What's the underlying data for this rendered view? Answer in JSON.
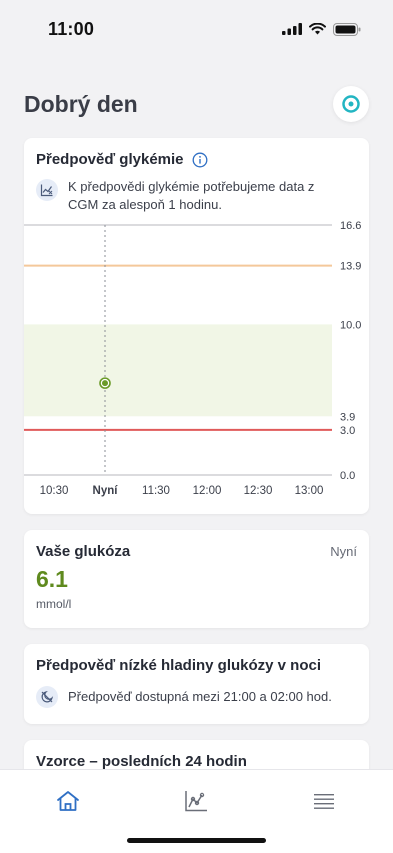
{
  "status_bar": {
    "time": "11:00"
  },
  "header": {
    "title": "Dobrý den"
  },
  "forecast": {
    "title": "Předpověď glykémie",
    "note": "K předpovědi glykémie potřebujeme data z CGM za alespoň 1 hodinu.",
    "chart_data": {
      "type": "scatter",
      "x_ticks": [
        "10:30",
        "Nyní",
        "11:30",
        "12:00",
        "12:30",
        "13:00"
      ],
      "current_tick": "Nyní",
      "y_ticks": [
        16.6,
        13.9,
        10.0,
        3.9,
        3.0,
        0.0
      ],
      "ylim": [
        0.0,
        16.6
      ],
      "target_range": [
        3.9,
        10.0
      ],
      "high_threshold": 13.9,
      "low_threshold": 3.0,
      "points": [
        {
          "x": "Nyní",
          "y": 6.1
        }
      ],
      "colors": {
        "target_band": "#f1f6e6",
        "high_line": "#f4c89a",
        "low_line": "#e05a5a",
        "point": "#6a9a28",
        "grid": "#cfcfd4"
      }
    }
  },
  "glucose": {
    "title": "Vaše glukóza",
    "time_label": "Nyní",
    "value": "6.1",
    "unit": "mmol/l"
  },
  "low_forecast": {
    "title": "Předpověď nízké hladiny glukózy v noci",
    "note": "Předpověď dostupná mezi 21:00 a 02:00 hod."
  },
  "patterns": {
    "title": "Vzorce – posledních 24 hodin"
  },
  "tabbar": {
    "items": [
      "home-icon",
      "chart-icon",
      "menu-icon"
    ],
    "active": "home-icon",
    "active_color": "#2f6fc4"
  }
}
